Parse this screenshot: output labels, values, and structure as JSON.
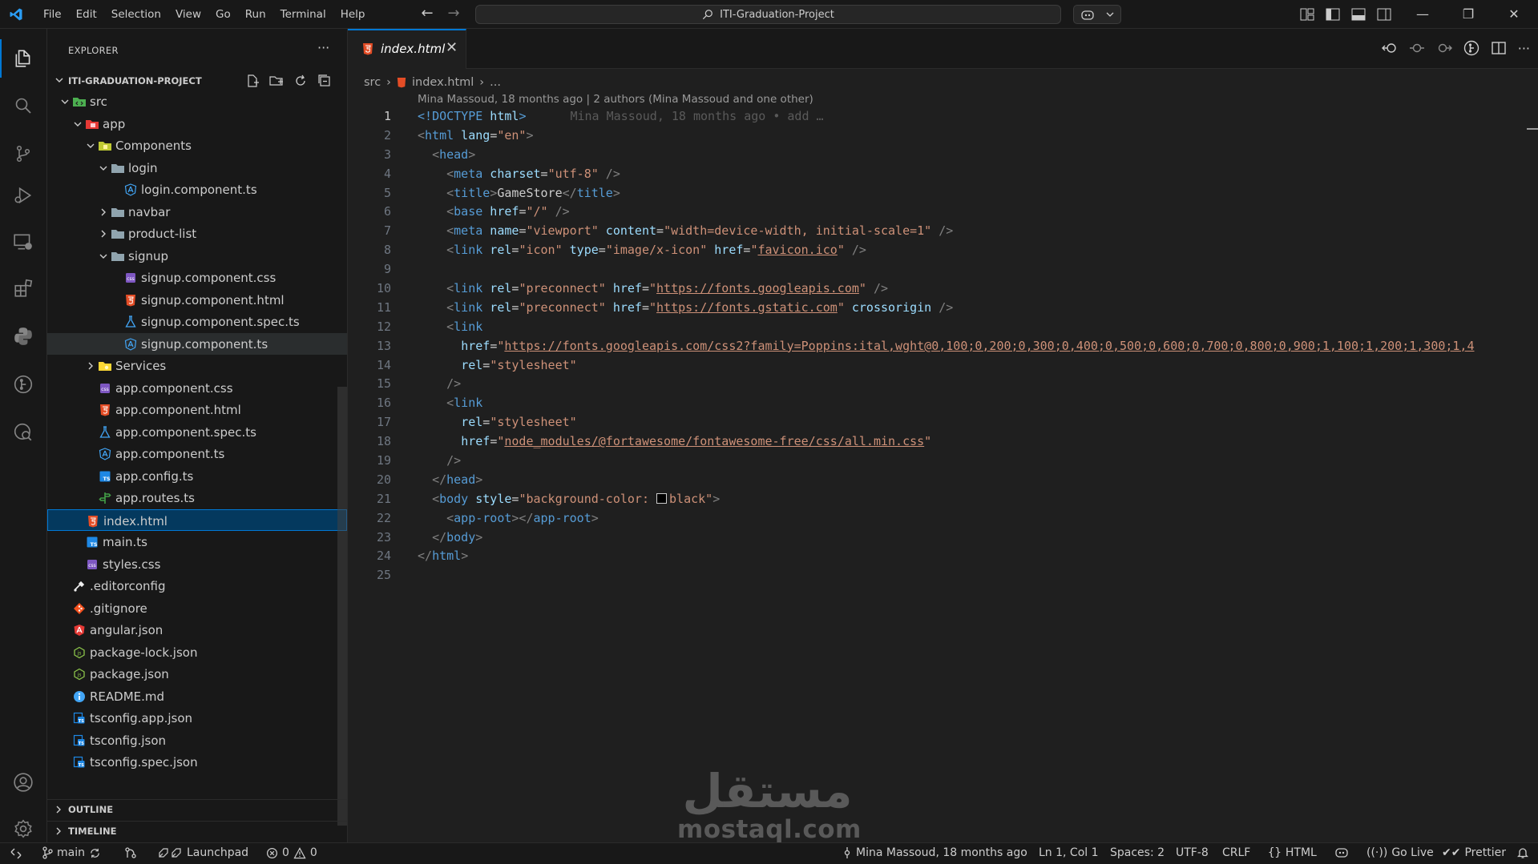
{
  "titlebar": {
    "menu": [
      "File",
      "Edit",
      "Selection",
      "View",
      "Go",
      "Run",
      "Terminal",
      "Help"
    ],
    "search": "ITI-Graduation-Project"
  },
  "explorer": {
    "title": "EXPLORER",
    "more": "···",
    "project": "ITI-GRADUATION-PROJECT",
    "items": [
      {
        "label": "src",
        "depth": 0,
        "kind": "folder-src",
        "state": "open"
      },
      {
        "label": "app",
        "depth": 1,
        "kind": "folder-app",
        "state": "open"
      },
      {
        "label": "Components",
        "depth": 2,
        "kind": "folder-comp",
        "state": "open"
      },
      {
        "label": "login",
        "depth": 3,
        "kind": "folder",
        "state": "open"
      },
      {
        "label": "login.component.ts",
        "depth": 4,
        "kind": "angular"
      },
      {
        "label": "navbar",
        "depth": 3,
        "kind": "folder",
        "state": "closed"
      },
      {
        "label": "product-list",
        "depth": 3,
        "kind": "folder",
        "state": "closed"
      },
      {
        "label": "signup",
        "depth": 3,
        "kind": "folder",
        "state": "open"
      },
      {
        "label": "signup.component.css",
        "depth": 4,
        "kind": "css"
      },
      {
        "label": "signup.component.html",
        "depth": 4,
        "kind": "html"
      },
      {
        "label": "signup.component.spec.ts",
        "depth": 4,
        "kind": "spec"
      },
      {
        "label": "signup.component.ts",
        "depth": 4,
        "kind": "angular",
        "state": "hover"
      },
      {
        "label": "Services",
        "depth": 2,
        "kind": "folder-svc",
        "state": "closed"
      },
      {
        "label": "app.component.css",
        "depth": 2,
        "kind": "css"
      },
      {
        "label": "app.component.html",
        "depth": 2,
        "kind": "html"
      },
      {
        "label": "app.component.spec.ts",
        "depth": 2,
        "kind": "spec"
      },
      {
        "label": "app.component.ts",
        "depth": 2,
        "kind": "angular"
      },
      {
        "label": "app.config.ts",
        "depth": 2,
        "kind": "ts"
      },
      {
        "label": "app.routes.ts",
        "depth": 2,
        "kind": "routes"
      },
      {
        "label": "index.html",
        "depth": 1,
        "kind": "html",
        "state": "selected"
      },
      {
        "label": "main.ts",
        "depth": 1,
        "kind": "ts"
      },
      {
        "label": "styles.css",
        "depth": 1,
        "kind": "css"
      },
      {
        "label": ".editorconfig",
        "depth": 0,
        "kind": "editorconfig"
      },
      {
        "label": ".gitignore",
        "depth": 0,
        "kind": "git"
      },
      {
        "label": "angular.json",
        "depth": 0,
        "kind": "angular-json"
      },
      {
        "label": "package-lock.json",
        "depth": 0,
        "kind": "npm"
      },
      {
        "label": "package.json",
        "depth": 0,
        "kind": "npm"
      },
      {
        "label": "README.md",
        "depth": 0,
        "kind": "info"
      },
      {
        "label": "tsconfig.app.json",
        "depth": 0,
        "kind": "tsconfig"
      },
      {
        "label": "tsconfig.json",
        "depth": 0,
        "kind": "tsconfig"
      },
      {
        "label": "tsconfig.spec.json",
        "depth": 0,
        "kind": "tsconfig"
      }
    ],
    "outline": "OUTLINE",
    "timeline": "TIMELINE"
  },
  "editor": {
    "tab": "index.html",
    "breadcrumb": {
      "folder": "src",
      "file": "index.html",
      "tail": "..."
    },
    "blame_header": "Mina Massoud, 18 months ago | 2 authors (Mina Massoud and one other)",
    "inline_blame": "Mina Massoud, 18 months ago • add …",
    "current_line": 1,
    "lines": [
      [
        [
          "doc",
          "<!"
        ],
        [
          "tag",
          "DOCTYPE"
        ],
        [
          "attr",
          " html"
        ],
        [
          "doc",
          ">"
        ]
      ],
      [
        [
          "punc",
          "<"
        ],
        [
          "tag",
          "html"
        ],
        [
          "attr",
          " lang"
        ],
        [
          "text",
          "="
        ],
        [
          "str",
          "\"en\""
        ],
        [
          "punc",
          ">"
        ]
      ],
      [
        [
          "text",
          "  "
        ],
        [
          "punc",
          "<"
        ],
        [
          "tag",
          "head"
        ],
        [
          "punc",
          ">"
        ]
      ],
      [
        [
          "text",
          "    "
        ],
        [
          "punc",
          "<"
        ],
        [
          "tag",
          "meta"
        ],
        [
          "attr",
          " charset"
        ],
        [
          "text",
          "="
        ],
        [
          "str",
          "\"utf-8\""
        ],
        [
          "punc",
          " />"
        ]
      ],
      [
        [
          "text",
          "    "
        ],
        [
          "punc",
          "<"
        ],
        [
          "tag",
          "title"
        ],
        [
          "punc",
          ">"
        ],
        [
          "text",
          "GameStore"
        ],
        [
          "punc",
          "</"
        ],
        [
          "tag",
          "title"
        ],
        [
          "punc",
          ">"
        ]
      ],
      [
        [
          "text",
          "    "
        ],
        [
          "punc",
          "<"
        ],
        [
          "tag",
          "base"
        ],
        [
          "attr",
          " href"
        ],
        [
          "text",
          "="
        ],
        [
          "str",
          "\"/\""
        ],
        [
          "punc",
          " />"
        ]
      ],
      [
        [
          "text",
          "    "
        ],
        [
          "punc",
          "<"
        ],
        [
          "tag",
          "meta"
        ],
        [
          "attr",
          " name"
        ],
        [
          "text",
          "="
        ],
        [
          "str",
          "\"viewport\""
        ],
        [
          "attr",
          " content"
        ],
        [
          "text",
          "="
        ],
        [
          "str",
          "\"width=device-width, initial-scale=1\""
        ],
        [
          "punc",
          " />"
        ]
      ],
      [
        [
          "text",
          "    "
        ],
        [
          "punc",
          "<"
        ],
        [
          "tag",
          "link"
        ],
        [
          "attr",
          " rel"
        ],
        [
          "text",
          "="
        ],
        [
          "str",
          "\"icon\""
        ],
        [
          "attr",
          " type"
        ],
        [
          "text",
          "="
        ],
        [
          "str",
          "\"image/x-icon\""
        ],
        [
          "attr",
          " href"
        ],
        [
          "text",
          "="
        ],
        [
          "str",
          "\""
        ],
        [
          "strlink",
          "favicon.ico"
        ],
        [
          "str",
          "\""
        ],
        [
          "punc",
          " />"
        ]
      ],
      [],
      [
        [
          "text",
          "    "
        ],
        [
          "punc",
          "<"
        ],
        [
          "tag",
          "link"
        ],
        [
          "attr",
          " rel"
        ],
        [
          "text",
          "="
        ],
        [
          "str",
          "\"preconnect\""
        ],
        [
          "attr",
          " href"
        ],
        [
          "text",
          "="
        ],
        [
          "str",
          "\""
        ],
        [
          "strlink",
          "https://fonts.googleapis.com"
        ],
        [
          "str",
          "\""
        ],
        [
          "punc",
          " />"
        ]
      ],
      [
        [
          "text",
          "    "
        ],
        [
          "punc",
          "<"
        ],
        [
          "tag",
          "link"
        ],
        [
          "attr",
          " rel"
        ],
        [
          "text",
          "="
        ],
        [
          "str",
          "\"preconnect\""
        ],
        [
          "attr",
          " href"
        ],
        [
          "text",
          "="
        ],
        [
          "str",
          "\""
        ],
        [
          "strlink",
          "https://fonts.gstatic.com"
        ],
        [
          "str",
          "\""
        ],
        [
          "attr",
          " crossorigin"
        ],
        [
          "punc",
          " />"
        ]
      ],
      [
        [
          "text",
          "    "
        ],
        [
          "punc",
          "<"
        ],
        [
          "tag",
          "link"
        ]
      ],
      [
        [
          "text",
          "      "
        ],
        [
          "attr",
          "href"
        ],
        [
          "text",
          "="
        ],
        [
          "str",
          "\""
        ],
        [
          "strlink",
          "https://fonts.googleapis.com/css2?family=Poppins:ital,wght@0,100;0,200;0,300;0,400;0,500;0,600;0,700;0,800;0,900;1,100;1,200;1,300;1,4"
        ]
      ],
      [
        [
          "text",
          "      "
        ],
        [
          "attr",
          "rel"
        ],
        [
          "text",
          "="
        ],
        [
          "str",
          "\"stylesheet\""
        ]
      ],
      [
        [
          "text",
          "    "
        ],
        [
          "punc",
          "/>"
        ]
      ],
      [
        [
          "text",
          "    "
        ],
        [
          "punc",
          "<"
        ],
        [
          "tag",
          "link"
        ]
      ],
      [
        [
          "text",
          "      "
        ],
        [
          "attr",
          "rel"
        ],
        [
          "text",
          "="
        ],
        [
          "str",
          "\"stylesheet\""
        ]
      ],
      [
        [
          "text",
          "      "
        ],
        [
          "attr",
          "href"
        ],
        [
          "text",
          "="
        ],
        [
          "str",
          "\""
        ],
        [
          "strlink",
          "node_modules/@fortawesome/fontawesome-free/css/all.min.css"
        ],
        [
          "str",
          "\""
        ]
      ],
      [
        [
          "text",
          "    "
        ],
        [
          "punc",
          "/>"
        ]
      ],
      [
        [
          "text",
          "  "
        ],
        [
          "punc",
          "</"
        ],
        [
          "tag",
          "head"
        ],
        [
          "punc",
          ">"
        ]
      ],
      [
        [
          "text",
          "  "
        ],
        [
          "punc",
          "<"
        ],
        [
          "tag",
          "body"
        ],
        [
          "attr",
          " style"
        ],
        [
          "text",
          "="
        ],
        [
          "str",
          "\"background-color: "
        ],
        [
          "swatch",
          ""
        ],
        [
          "str",
          "black\""
        ],
        [
          "punc",
          ">"
        ]
      ],
      [
        [
          "text",
          "    "
        ],
        [
          "punc",
          "<"
        ],
        [
          "tag",
          "app-root"
        ],
        [
          "punc",
          "></"
        ],
        [
          "tag",
          "app-root"
        ],
        [
          "punc",
          ">"
        ]
      ],
      [
        [
          "text",
          "  "
        ],
        [
          "punc",
          "</"
        ],
        [
          "tag",
          "body"
        ],
        [
          "punc",
          ">"
        ]
      ],
      [
        [
          "punc",
          "</"
        ],
        [
          "tag",
          "html"
        ],
        [
          "punc",
          ">"
        ]
      ],
      []
    ]
  },
  "watermark": {
    "arabic": "مستقل",
    "latin": "mostaql.com"
  },
  "status": {
    "branch": "main",
    "launchpad": "Launchpad",
    "errors": "0",
    "warnings": "0",
    "blame": "Mina Massoud, 18 months ago",
    "position": "Ln 1, Col 1",
    "spaces": "Spaces: 2",
    "encoding": "UTF-8",
    "eol": "CRLF",
    "language": "HTML",
    "golive": "Go Live",
    "prettier": "Prettier"
  },
  "colors": {
    "accent": "#0078d4",
    "tag": "#569cd6",
    "attr": "#9cdcfe",
    "string": "#ce9178"
  }
}
